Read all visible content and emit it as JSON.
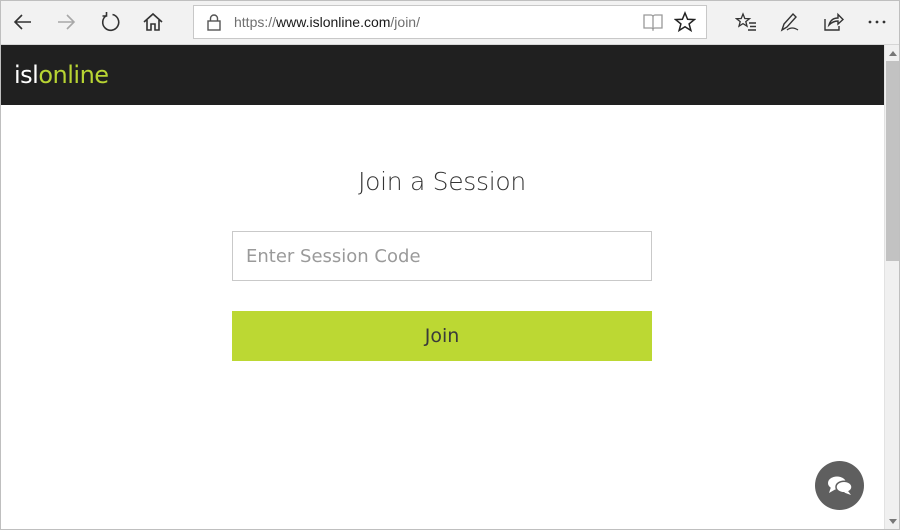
{
  "browser": {
    "url_prefix": "https://",
    "url_host": "www.islonline.com",
    "url_path": "/join/",
    "buttons": {
      "back": "back-arrow-icon",
      "forward": "forward-arrow-icon",
      "refresh": "refresh-icon",
      "home": "home-icon",
      "favorites": "favorites-list-icon",
      "notes": "pen-icon",
      "share": "share-icon",
      "more": "more-icon"
    }
  },
  "header": {
    "logo_part1": "isl",
    "logo_part2": "online",
    "background": "#202020",
    "accent": "#b8d433"
  },
  "main": {
    "title": "Join a Session",
    "input_placeholder": "Enter Session Code",
    "input_value": "",
    "join_label": "Join",
    "button_color": "#bcd833"
  },
  "chat": {
    "icon": "chat-bubbles-icon",
    "color": "#5f5f5f"
  }
}
